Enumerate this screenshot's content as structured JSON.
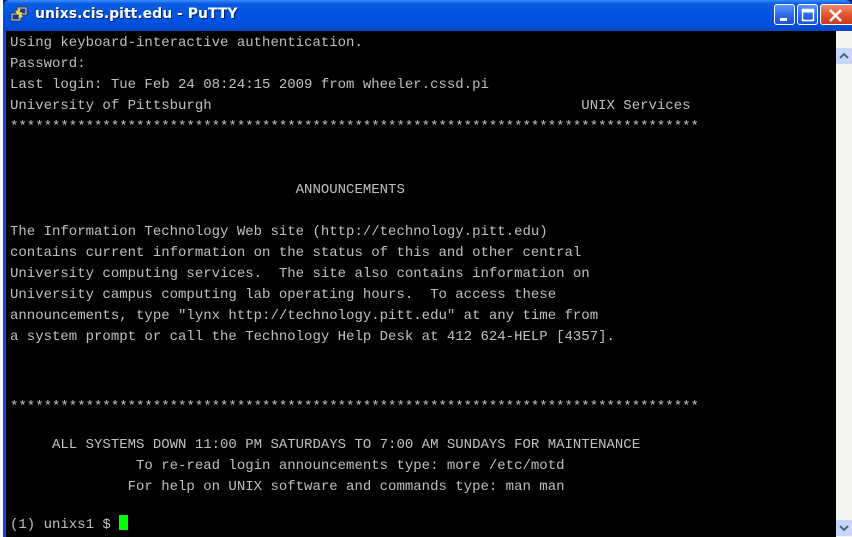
{
  "window": {
    "title": "unixs.cis.pitt.edu - PuTTY",
    "icons": {
      "app": "putty-icon",
      "minimize": "minimize-icon",
      "maximize": "maximize-icon",
      "close": "close-icon"
    }
  },
  "terminal": {
    "lines": [
      "Using keyboard-interactive authentication.",
      "Password:",
      "Last login: Tue Feb 24 08:24:15 2009 from wheeler.cssd.pi",
      "University of Pittsburgh                                            UNIX Services",
      "**********************************************************************************",
      "",
      "",
      "                                  ANNOUNCEMENTS",
      "",
      "The Information Technology Web site (http://technology.pitt.edu)",
      "contains current information on the status of this and other central",
      "University computing services.  The site also contains information on",
      "University campus computing lab operating hours.  To access these",
      "announcements, type \"lynx http://technology.pitt.edu\" at any time from",
      "a system prompt or call the Technology Help Desk at 412 624-HELP [4357].",
      "",
      "",
      "",
      "**********************************************************************************",
      "",
      "     ALL SYSTEMS DOWN 11:00 PM SATURDAYS TO 7:00 AM SUNDAYS FOR MAINTENANCE",
      "               To re-read login announcements type: more /etc/motd",
      "              For help on UNIX software and commands type: man man",
      "",
      "(1) unixs1 $ "
    ],
    "colors": {
      "background": "#000000",
      "text": "#c0c0c0",
      "cursor": "#00ff00"
    }
  }
}
